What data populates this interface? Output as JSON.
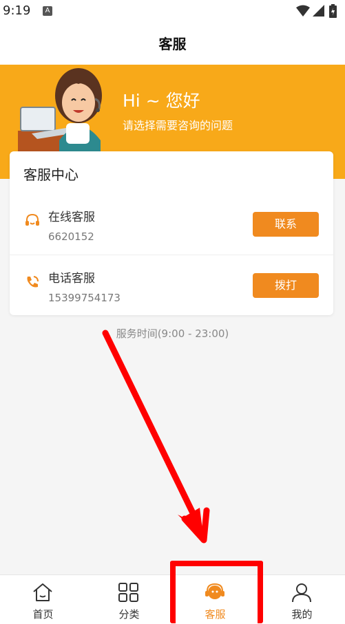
{
  "status_bar": {
    "time": "9:19",
    "notification_icon_letter": "A"
  },
  "header": {
    "title": "客服"
  },
  "banner": {
    "greeting": "Hi ~ 您好",
    "subtitle": "请选择需要咨询的问题"
  },
  "service_center": {
    "title": "客服中心",
    "rows": [
      {
        "name": "在线客服",
        "value": "6620152",
        "button": "联系",
        "icon": "headset-icon"
      },
      {
        "name": "电话客服",
        "value": "15399754173",
        "button": "拨打",
        "icon": "phone-icon"
      }
    ],
    "hours": "服务时间(9:00 - 23:00)"
  },
  "tabbar": {
    "active": "客服",
    "items": [
      {
        "label": "首页",
        "icon": "home-icon"
      },
      {
        "label": "分类",
        "icon": "category-grid-icon"
      },
      {
        "label": "客服",
        "icon": "customer-service-icon"
      },
      {
        "label": "我的",
        "icon": "user-icon"
      }
    ]
  },
  "colors": {
    "accent": "#f08a1f",
    "banner": "#f8a919",
    "annotation": "#ff0000"
  }
}
